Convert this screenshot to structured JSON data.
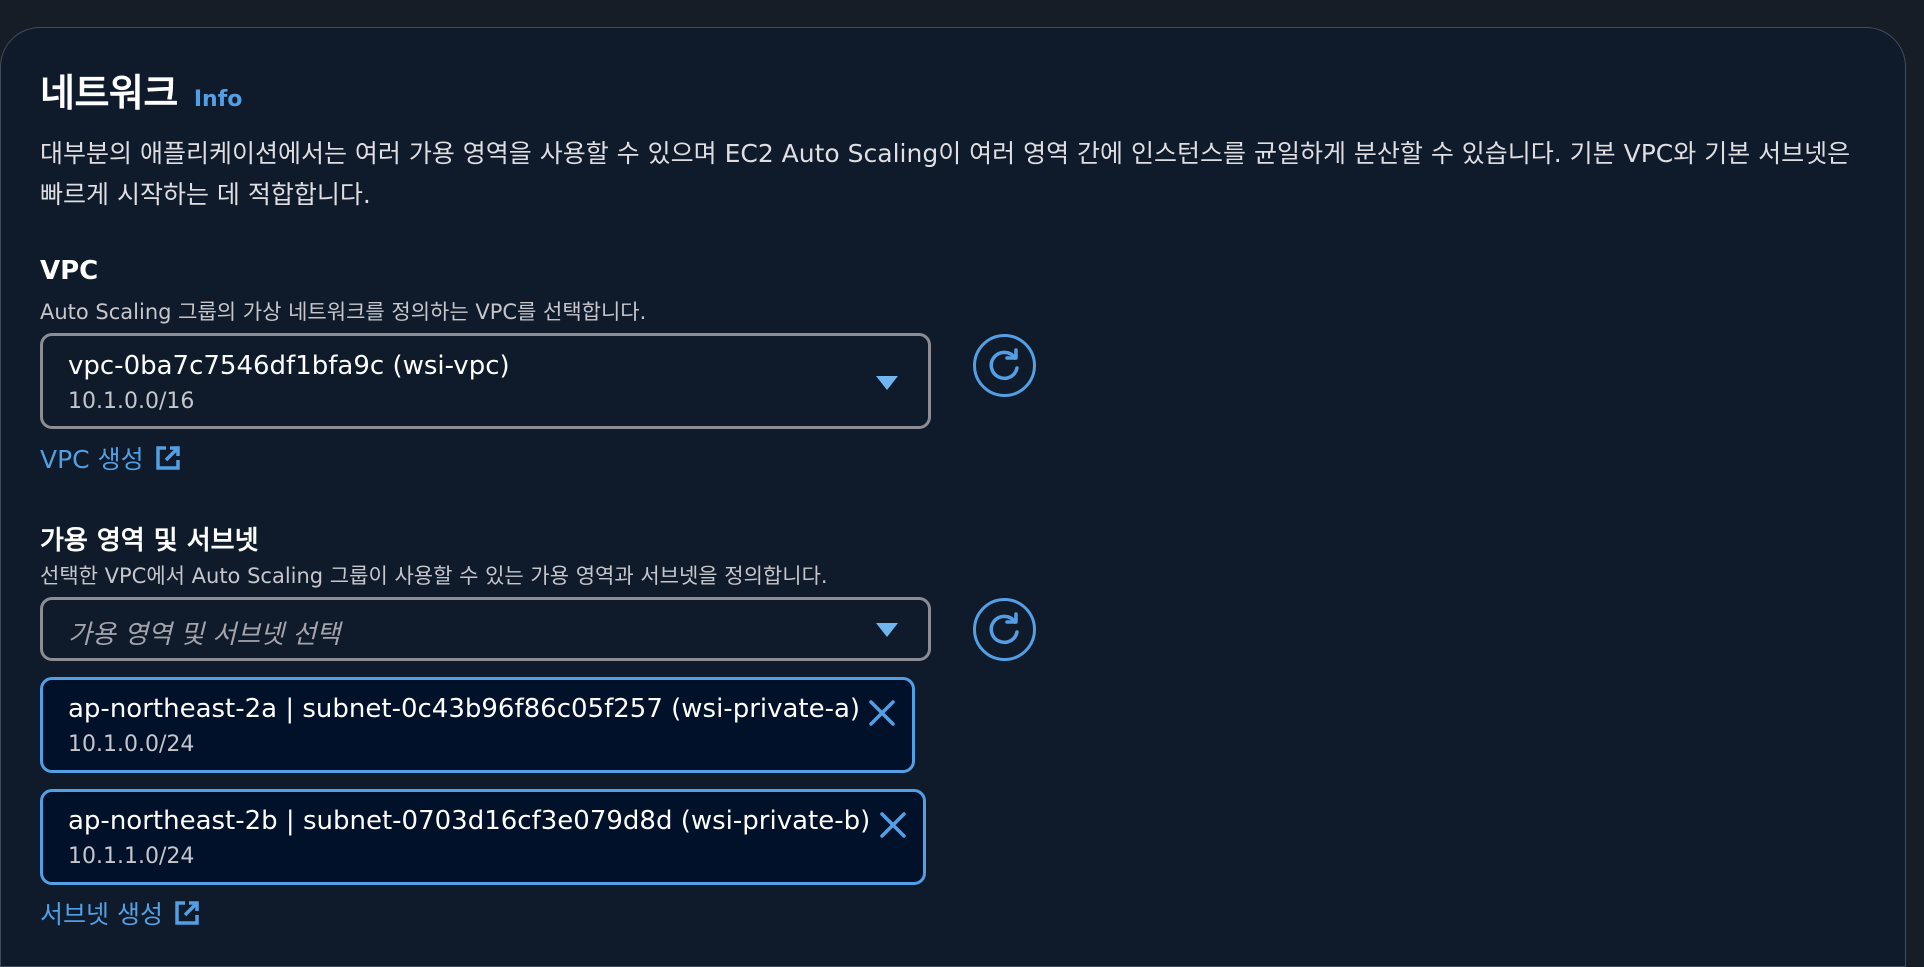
{
  "network": {
    "title": "네트워크",
    "info_label": "Info",
    "description": "대부분의 애플리케이션에서는 여러 가용 영역을 사용할 수 있으며 EC2 Auto Scaling이 여러 영역 간에 인스턴스를 균일하게 분산할 수 있습니다. 기본 VPC와 기본 서브넷은 빠르게 시작하는 데 적합합니다."
  },
  "vpc": {
    "label": "VPC",
    "description": "Auto Scaling 그룹의 가상 네트워크를 정의하는 VPC를 선택합니다.",
    "selected_value": "vpc-0ba7c7546df1bfa9c (wsi-vpc)",
    "selected_cidr": "10.1.0.0/16",
    "create_link": "VPC 생성"
  },
  "subnets": {
    "label": "가용 영역 및 서브넷",
    "description": "선택한 VPC에서 Auto Scaling 그룹이 사용할 수 있는 가용 영역과 서브넷을 정의합니다.",
    "placeholder": "가용 영역 및 서브넷 선택",
    "selected": [
      {
        "name": "ap-northeast-2a | subnet-0c43b96f86c05f257 (wsi-private-a)",
        "cidr": "10.1.0.0/24"
      },
      {
        "name": "ap-northeast-2b | subnet-0703d16cf3e079d8d (wsi-private-b)",
        "cidr": "10.1.1.0/24"
      }
    ],
    "create_link": "서브넷 생성"
  },
  "colors": {
    "background": "#161d26",
    "panel": "#0f1b2a",
    "accent": "#539fe5",
    "token_bg": "#001129",
    "border": "#8c8c94"
  },
  "icons": {
    "refresh": "refresh-icon",
    "caret": "caret-down-icon",
    "external": "external-link-icon",
    "remove": "close-icon"
  }
}
